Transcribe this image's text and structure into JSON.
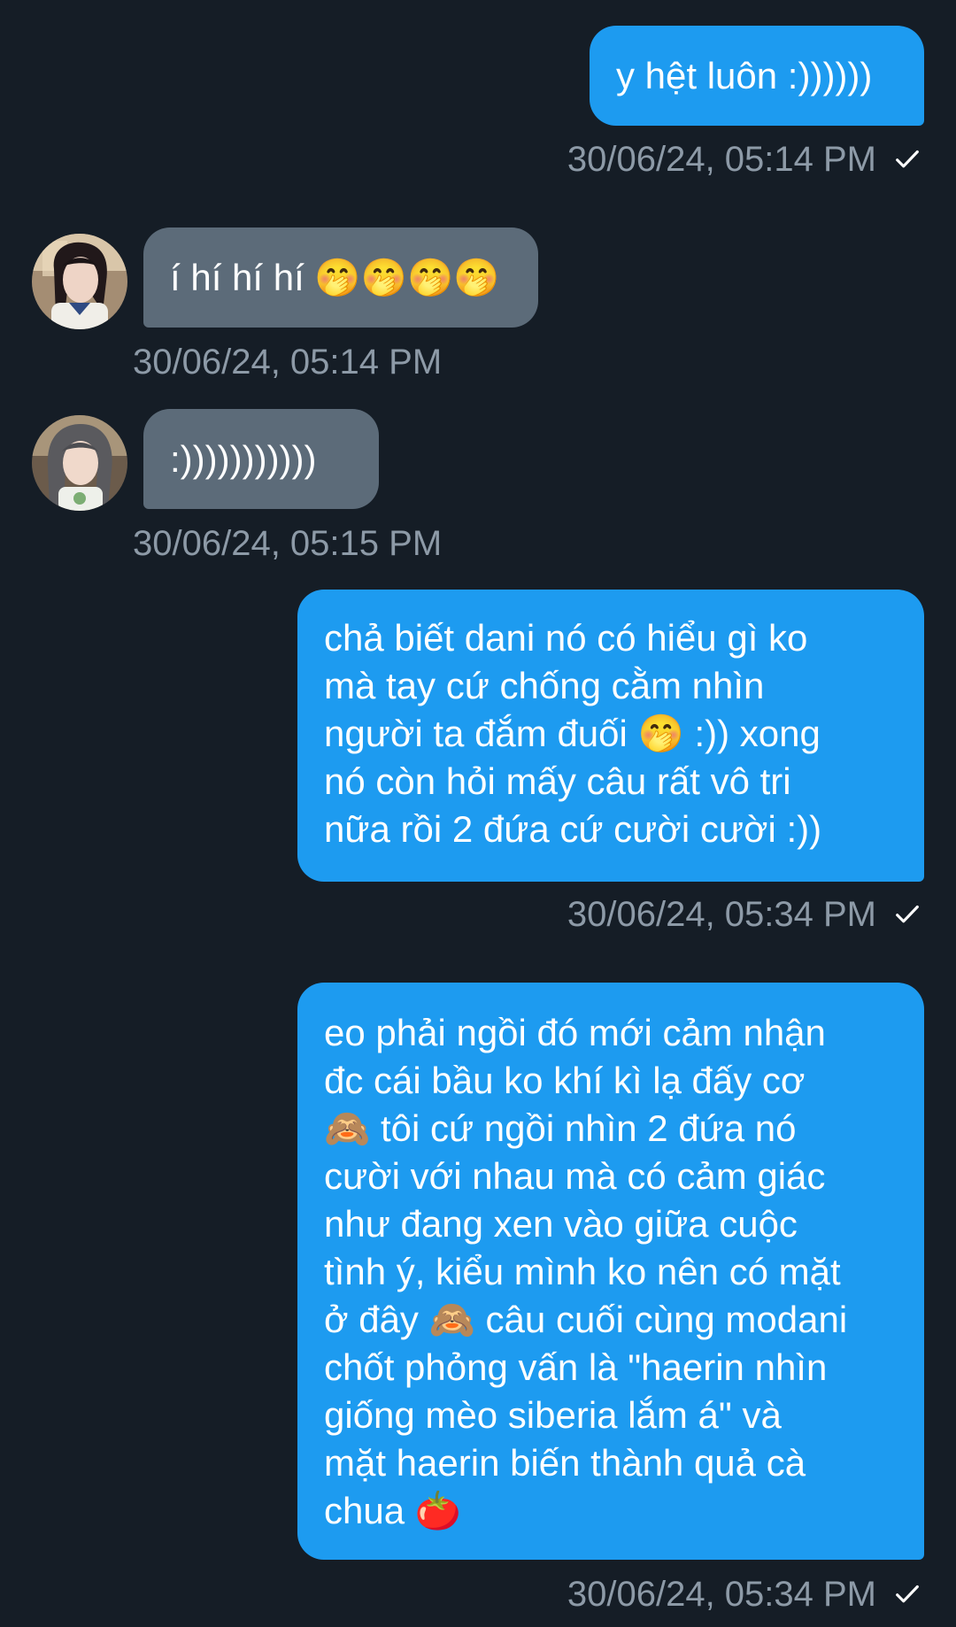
{
  "chat": {
    "messages": [
      {
        "direction": "sent",
        "text": "y hệt luôn :))))))",
        "time": "30/06/24, 05:14 PM",
        "status_icon": "check-icon"
      },
      {
        "direction": "received",
        "text": "í hí hí hí 🤭🤭🤭🤭",
        "time": "30/06/24, 05:14 PM",
        "avatar_icon": "profile-avatar"
      },
      {
        "direction": "received",
        "text": ":)))))))))))",
        "time": "30/06/24, 05:15 PM",
        "avatar_icon": "profile-avatar"
      },
      {
        "direction": "sent",
        "text": "chả biết dani nó có hiểu gì ko\nmà tay cứ chống cằm nhìn\nngười ta đắm đuối 🤭 :)) xong\nnó còn hỏi mấy câu rất vô tri\nnữa rồi 2 đứa cứ cười cười :))",
        "time": "30/06/24, 05:34 PM",
        "status_icon": "check-icon"
      },
      {
        "direction": "sent",
        "text": "eo phải ngồi đó mới cảm nhận\nđc cái bầu ko khí kì lạ đấy cơ\n🙈 tôi cứ ngồi nhìn 2 đứa nó\ncười với nhau mà có cảm giác\nnhư đang xen vào giữa cuộc\ntình ý, kiểu mình ko nên có mặt\nở đây 🙈 câu cuối cùng modani\nchốt phỏng vấn là \"haerin nhìn\ngiống mèo siberia lắm á\" và\nmặt haerin biến thành quả cà\nchua 🍅",
        "time": "30/06/24, 05:34 PM",
        "status_icon": "check-icon"
      }
    ]
  },
  "colors": {
    "background": "#151d26",
    "sent_bubble": "#1d9bf0",
    "received_bubble": "#5c6b79",
    "timestamp": "#8d9aa7",
    "text": "#ffffff"
  }
}
